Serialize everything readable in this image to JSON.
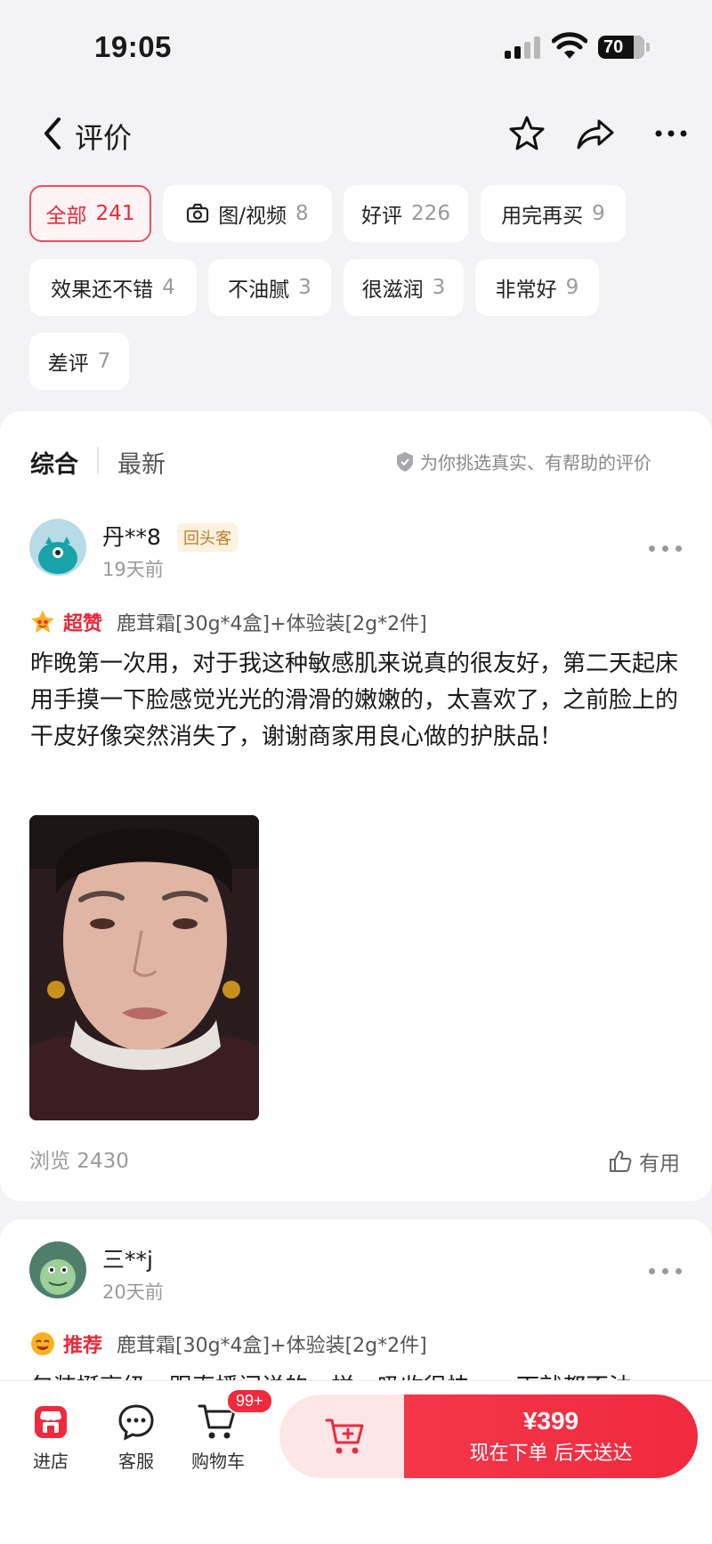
{
  "status": {
    "time": "19:05",
    "battery": "70"
  },
  "header": {
    "title": "评价",
    "icons": [
      "back-icon",
      "star-icon",
      "share-icon",
      "more-icon"
    ]
  },
  "filters": [
    {
      "label": "全部",
      "count": "241",
      "active": true
    },
    {
      "label": "图/视频",
      "count": "8",
      "icon": "camera-icon"
    },
    {
      "label": "好评",
      "count": "226"
    },
    {
      "label": "用完再买",
      "count": "9"
    },
    {
      "label": "效果还不错",
      "count": "4"
    },
    {
      "label": "不油腻",
      "count": "3"
    },
    {
      "label": "很滋润",
      "count": "3"
    },
    {
      "label": "非常好",
      "count": "9"
    },
    {
      "label": "差评",
      "count": "7"
    }
  ],
  "sort": {
    "primary": "综合",
    "secondary": "最新",
    "hint": "为你挑选真实、有帮助的评价"
  },
  "reviews": [
    {
      "user": "丹**8",
      "badge": "回头客",
      "time": "19天前",
      "rating_label": "超赞",
      "spec": "鹿茸霜[30g*4盒]+体验装[2g*2件]",
      "content": "昨晚第一次用，对于我这种敏感肌来说真的很友好，第二天起床用手摸一下脸感觉光光的滑滑的嫩嫩的，太喜欢了，之前脸上的干皮好像突然消失了，谢谢商家用良心做的护肤品！",
      "views": "浏览 2430",
      "useful": "有用"
    },
    {
      "user": "三**j",
      "time": "20天前",
      "rating_label": "推荐",
      "spec": "鹿茸霜[30g*4盒]+体验装[2g*2件]",
      "content_preview": "包装挺高级，跟直播间说的一样，吸收很快，一下就都不油"
    }
  ],
  "bottom": {
    "store": "进店",
    "service": "客服",
    "cart": "购物车",
    "cart_badge": "99+",
    "price": "¥399",
    "buy_label": "现在下单 后天送达"
  },
  "colors": {
    "accent": "#ef2a3d",
    "background": "#f3f3f5"
  }
}
